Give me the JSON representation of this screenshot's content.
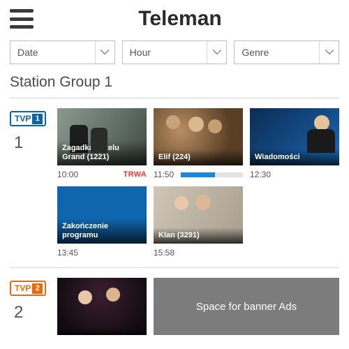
{
  "header": {
    "title": "Teleman"
  },
  "filters": {
    "date_label": "Date",
    "hour_label": "Hour",
    "genre_label": "Genre"
  },
  "group": {
    "title": "Station Group 1"
  },
  "stations": [
    {
      "num": "1",
      "logo_text": "TVP",
      "logo_badge": "1",
      "programs": [
        {
          "title": "Zagadka Hotelu Grand (1221)",
          "time": "10:00",
          "live": "TRWA",
          "thumb": "th-grand"
        },
        {
          "title": "Elif (224)",
          "time": "11:50",
          "progress": 55,
          "thumb": "th-elif"
        },
        {
          "title": "Wiadomości",
          "time": "12:30",
          "thumb": "th-wiad"
        },
        {
          "title": "Zakończenie programu",
          "time": "13:45",
          "thumb": "th-zak"
        },
        {
          "title": "Klan (3291)",
          "time": "15:58",
          "thumb": "th-klan"
        }
      ]
    },
    {
      "num": "2",
      "logo_text": "TVP",
      "logo_badge": "2",
      "programs": [
        {
          "title": "",
          "time": "",
          "thumb": "th-tvp2a"
        }
      ],
      "ad_text": "Space for banner Ads"
    }
  ]
}
